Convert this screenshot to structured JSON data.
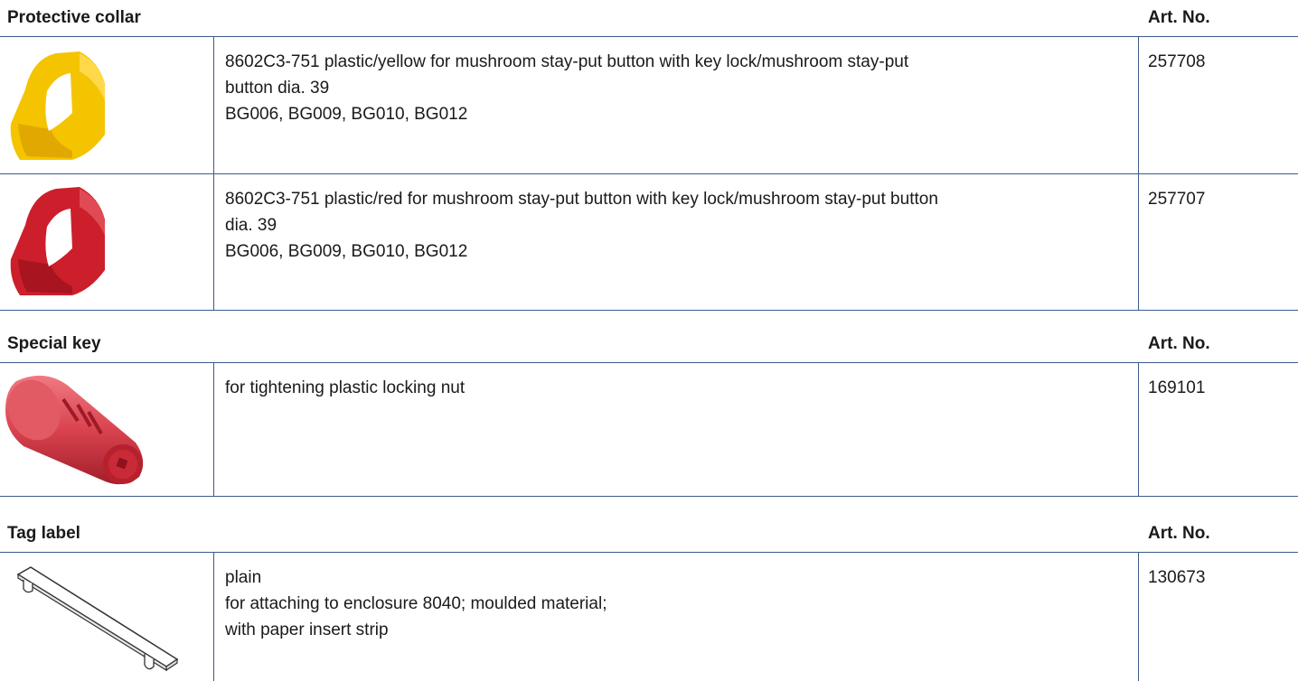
{
  "sections": [
    {
      "title": "Protective collar",
      "artno_header": "Art. No.",
      "rows": [
        {
          "desc_lines": [
            "8602C3-751 plastic/yellow for mushroom stay-put button with key lock/mushroom stay-put",
            "button dia. 39",
            "BG006, BG009, BG010, BG012"
          ],
          "art_no": "257708",
          "image_icon": "yellow-collar-icon",
          "color": "#f5c400"
        },
        {
          "desc_lines": [
            "8602C3-751 plastic/red for mushroom stay-put button with key lock/mushroom stay-put button",
            "dia. 39",
            "BG006, BG009, BG010, BG012"
          ],
          "art_no": "257707",
          "image_icon": "red-collar-icon",
          "color": "#cc1f2b"
        }
      ]
    },
    {
      "title": "Special key",
      "artno_header": "Art. No.",
      "rows": [
        {
          "desc_lines": [
            "for tightening plastic locking nut"
          ],
          "art_no": "169101",
          "image_icon": "special-key-icon",
          "color": "#d9434f"
        }
      ]
    },
    {
      "title": "Tag label",
      "artno_header": "Art. No.",
      "rows": [
        {
          "desc_lines": [
            "plain",
            "for attaching to enclosure 8040; moulded material;",
            "with paper insert strip"
          ],
          "art_no": "130673",
          "image_icon": "tag-label-icon",
          "color": "#ffffff"
        }
      ]
    }
  ]
}
